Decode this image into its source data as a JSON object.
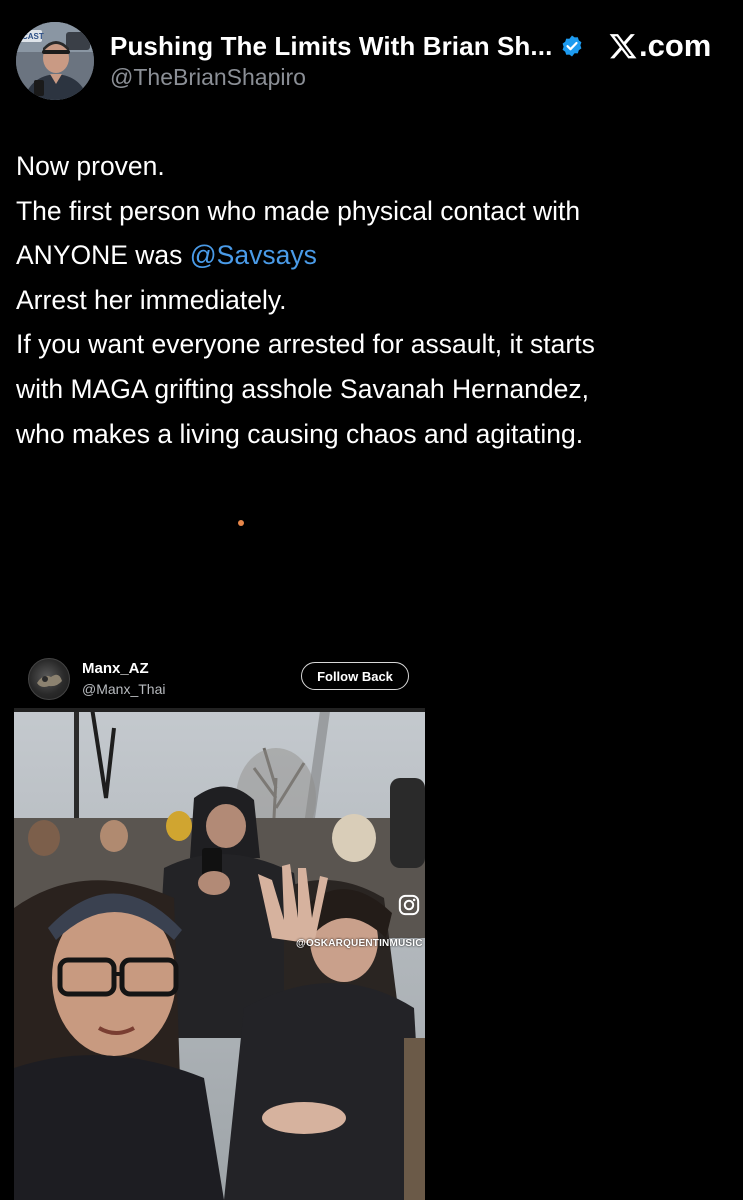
{
  "post": {
    "display_name": "Pushing The Limits With Brian Sh...",
    "handle": "@TheBrianShapiro",
    "site_label": ".com",
    "lines": [
      {
        "pre": "Now proven.",
        "mention": "",
        "post": ""
      },
      {
        "pre": "The first person who made physical contact with",
        "mention": "",
        "post": ""
      },
      {
        "pre": "ANYONE was ",
        "mention": "@Savsays",
        "post": ""
      },
      {
        "pre": "Arrest her immediately.",
        "mention": "",
        "post": ""
      },
      {
        "pre": "If you want everyone arrested for assault, it starts",
        "mention": "",
        "post": ""
      },
      {
        "pre": "with MAGA grifting asshole Savanah Hernandez,",
        "mention": "",
        "post": ""
      },
      {
        "pre": "who makes a living causing chaos and agitating.",
        "mention": "",
        "post": ""
      }
    ]
  },
  "embed": {
    "name": "Manx_AZ",
    "handle": "@Manx_Thai",
    "follow_label": "Follow Back",
    "watermark": "@OSKARQUENTINMUSIC"
  },
  "avatar_badge_text": "CAST"
}
